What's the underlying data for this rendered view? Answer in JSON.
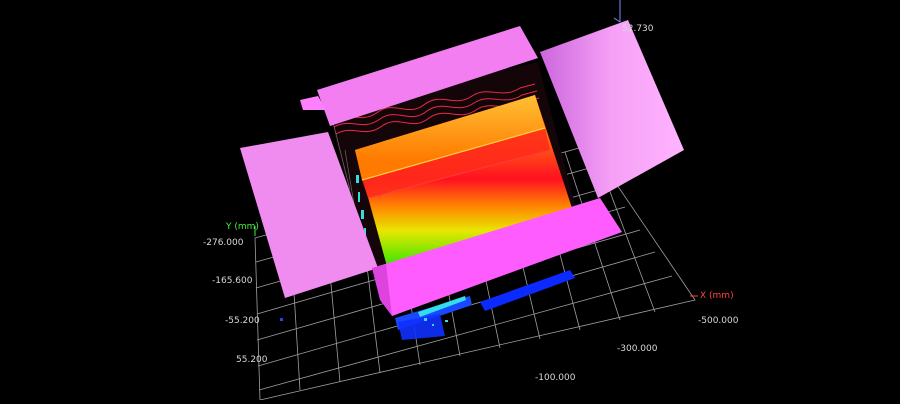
{
  "viewer": {
    "y_axis": {
      "label": "Y (mm)",
      "ticks": [
        "-276.000",
        "-165.600",
        "-55.200",
        "55.200"
      ],
      "color": "#44ee44"
    },
    "x_axis": {
      "label": "X (mm)",
      "ticks": [
        "-500.000",
        "-300.000",
        "-100.000"
      ],
      "color": "#ff4444"
    },
    "z_axis": {
      "top_value": "52.730",
      "color": "#8888ff"
    },
    "colors": {
      "background": "#000000",
      "grid": "#bdbdbd",
      "flap": "#ee88ee",
      "box_wall": "#ff66ff",
      "measure_low": "#0033ff",
      "measure_high": "#ff00ff"
    }
  }
}
